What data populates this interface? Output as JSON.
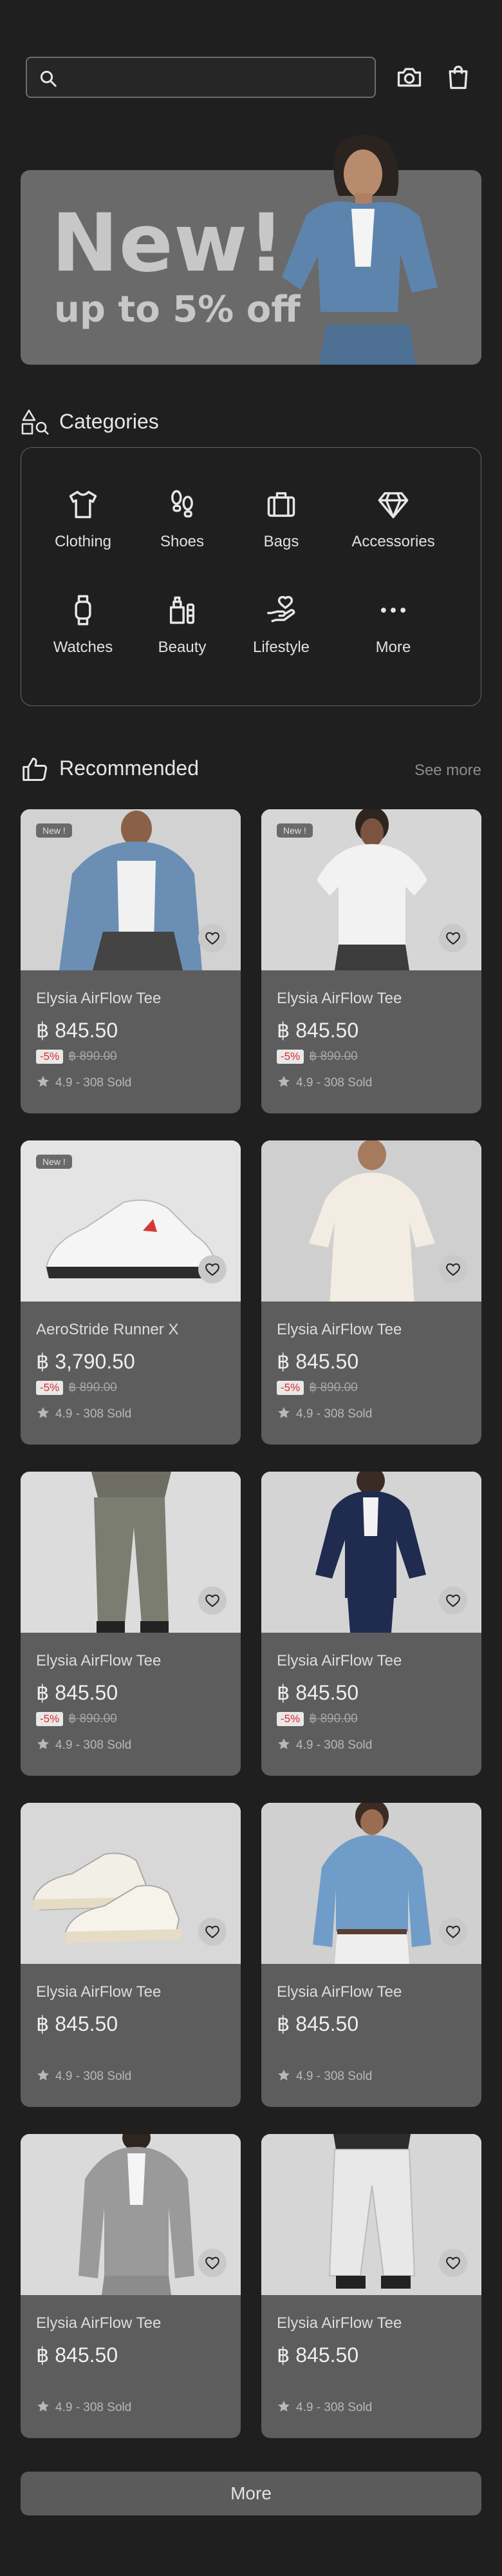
{
  "search": {
    "placeholder": "",
    "value": ""
  },
  "banner": {
    "title": "New!",
    "subtitle": "up to 5% off"
  },
  "categories": {
    "title": "Categories",
    "items": [
      {
        "label": "Clothing",
        "icon": "tshirt-icon"
      },
      {
        "label": "Shoes",
        "icon": "footprints-icon"
      },
      {
        "label": "Bags",
        "icon": "briefcase-icon"
      },
      {
        "label": "Accessories",
        "icon": "diamond-icon"
      },
      {
        "label": "Watches",
        "icon": "watch-icon"
      },
      {
        "label": "Beauty",
        "icon": "perfume-icon"
      },
      {
        "label": "Lifestyle",
        "icon": "hand-heart-icon"
      },
      {
        "label": "More",
        "icon": "dots-icon"
      }
    ]
  },
  "recommended": {
    "title": "Recommended",
    "see_more": "See more",
    "products": [
      {
        "name": "Elysia AirFlow Tee",
        "price": "฿ 845.50",
        "discount": "-5%",
        "old_price": "฿ 890.00",
        "rating": "4.9 - 308 Sold",
        "badge": "New !"
      },
      {
        "name": "Elysia AirFlow Tee",
        "price": "฿ 845.50",
        "discount": "-5%",
        "old_price": "฿ 890.00",
        "rating": "4.9 - 308 Sold",
        "badge": "New !"
      },
      {
        "name": "AeroStride Runner X",
        "price": "฿ 3,790.50",
        "discount": "-5%",
        "old_price": "฿ 890.00",
        "rating": "4.9 - 308 Sold",
        "badge": "New !"
      },
      {
        "name": "Elysia AirFlow Tee",
        "price": "฿ 845.50",
        "discount": "-5%",
        "old_price": "฿ 890.00",
        "rating": "4.9 - 308 Sold",
        "badge": ""
      },
      {
        "name": "Elysia AirFlow Tee",
        "price": "฿ 845.50",
        "discount": "-5%",
        "old_price": "฿ 890.00",
        "rating": "4.9 - 308 Sold",
        "badge": ""
      },
      {
        "name": "Elysia AirFlow Tee",
        "price": "฿ 845.50",
        "discount": "-5%",
        "old_price": "฿ 890.00",
        "rating": "4.9 - 308 Sold",
        "badge": ""
      },
      {
        "name": "Elysia AirFlow Tee",
        "price": "฿ 845.50",
        "discount": "",
        "old_price": "",
        "rating": "4.9 - 308 Sold",
        "badge": ""
      },
      {
        "name": "Elysia AirFlow Tee",
        "price": "฿ 845.50",
        "discount": "",
        "old_price": "",
        "rating": "4.9 - 308 Sold",
        "badge": ""
      },
      {
        "name": "Elysia AirFlow Tee",
        "price": "฿ 845.50",
        "discount": "",
        "old_price": "",
        "rating": "4.9 - 308 Sold",
        "badge": ""
      },
      {
        "name": "Elysia AirFlow Tee",
        "price": "฿ 845.50",
        "discount": "",
        "old_price": "",
        "rating": "4.9 - 308 Sold",
        "badge": ""
      }
    ]
  },
  "more_button": "More",
  "colors": {
    "background": "#1f1f1f",
    "card": "#5d5d5d",
    "discount": "#e02a2a"
  }
}
